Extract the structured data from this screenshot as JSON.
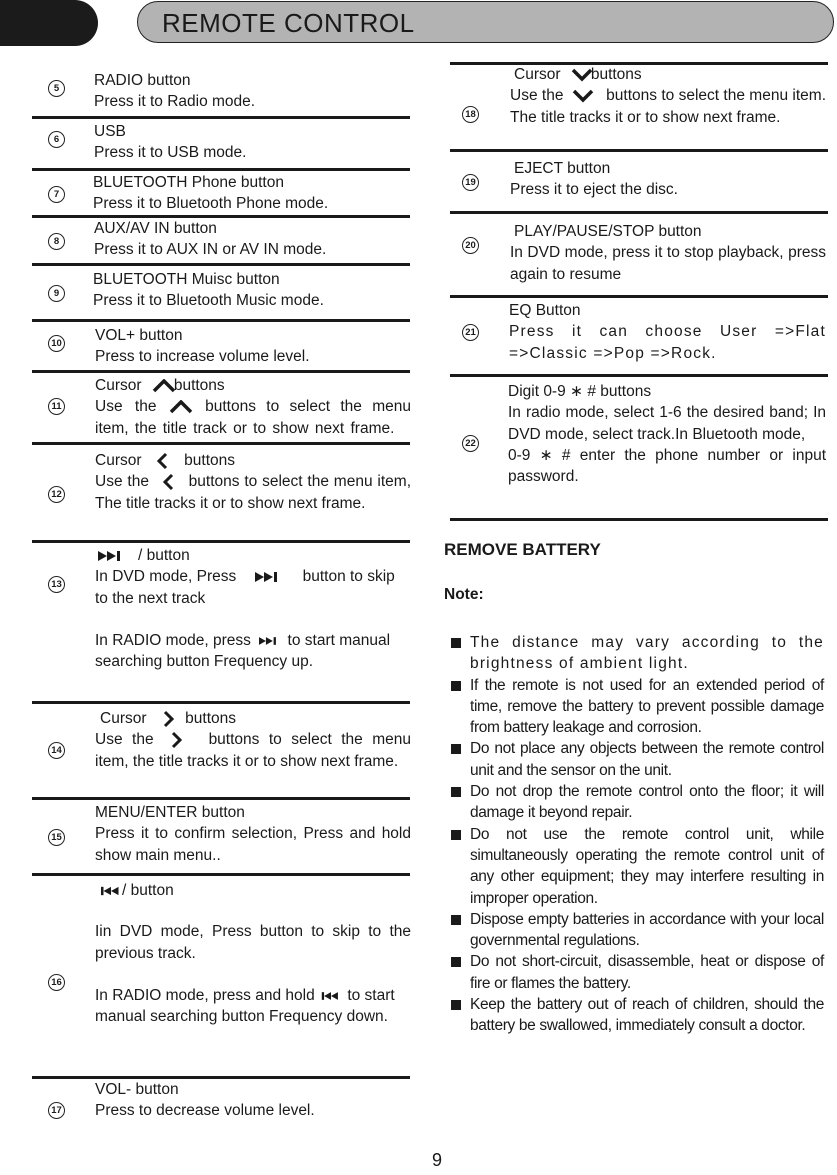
{
  "header": {
    "title": "REMOTE CONTROL"
  },
  "left_items": [
    {
      "num": "5",
      "title": "RADIO button",
      "desc": "Press it to Radio mode."
    },
    {
      "num": "6",
      "title": "USB",
      "desc": "Press it to USB mode."
    },
    {
      "num": "7",
      "title": "BLUETOOTH Phone button",
      "desc": "Press it to Bluetooth Phone mode."
    },
    {
      "num": "8",
      "title": "AUX/AV IN button",
      "desc": "Press it to AUX IN or AV IN mode."
    },
    {
      "num": "9",
      "title": "BLUETOOTH Muisc button",
      "desc": "Press it to Bluetooth Music mode."
    },
    {
      "num": "10",
      "title": "VOL+ button",
      "desc": "Press to increase volume level."
    },
    {
      "num": "11",
      "title_pre": "Cursor",
      "title_post": "buttons",
      "icon": "chevron-up-icon",
      "desc_pre": "Use the",
      "desc_post": "buttons to select the menu item, the title track or to show next frame."
    },
    {
      "num": "12",
      "title_pre": "Cursor",
      "title_post": "buttons",
      "icon": "chevron-left-icon",
      "desc_pre": "Use the",
      "desc_post": "buttons to select the menu item,  The title tracks it or to show next frame."
    },
    {
      "num": "13",
      "title_post": "/ button",
      "icon": "skip-next-icon",
      "line1_pre": "In DVD mode, Press",
      "line1_post": "button to skip to the next track",
      "line2_pre": "In RADIO mode, press",
      "line2_post": "to start manual searching  button Frequency up."
    },
    {
      "num": "14",
      "title_pre": "Cursor",
      "title_post": "buttons",
      "icon": "chevron-right-icon",
      "desc_pre": "Use the",
      "desc_post": "buttons to select the menu item, the title tracks it or to show next frame."
    },
    {
      "num": "15",
      "title": "MENU/ENTER button",
      "desc": "Press it to confirm selection, Press and hold show main menu.."
    },
    {
      "num": "16",
      "title_post": "/ button",
      "icon": "skip-previous-icon",
      "line1": "Iin DVD mode, Press  button to skip to the previous track.",
      "line2_pre": "In RADIO mode, press and hold",
      "line2_post": "to start manual searching   button Frequency down."
    },
    {
      "num": "17",
      "title": "VOL- button",
      "desc": "Press to decrease volume level."
    }
  ],
  "right_items": [
    {
      "num": "18",
      "title_pre": "Cursor",
      "title_post": "buttons",
      "icon": "chevron-down-icon",
      "desc_pre": "Use the",
      "desc_post": "buttons to select the menu item. The title tracks it or to show next frame."
    },
    {
      "num": "19",
      "title": "EJECT button",
      "desc": "Press it to eject the disc."
    },
    {
      "num": "20",
      "title": "PLAY/PAUSE/STOP button",
      "desc": "In DVD mode, press it to stop playback, press again to resume"
    },
    {
      "num": "21",
      "title": "EQ Button",
      "desc": "Press it can choose User =>Flat =>Classic =>Pop =>Rock."
    },
    {
      "num": "22",
      "title": "Digit 0-9  ∗  # buttons",
      "desc": "In radio mode, select 1-6 the desired band; In DVD mode, select track.In Bluetooth mode,",
      "desc2": "0-9 ∗  # enter the phone number or input password."
    }
  ],
  "battery": {
    "heading": "REMOVE BATTERY",
    "note_label": "Note:",
    "notes": [
      "The distance may vary according to the brightness of ambient light.",
      "If the remote is not used for an extended period of time, remove the battery to prevent possible damage from battery leakage and corrosion.",
      " Do not place any objects between the remote control unit and the sensor on the unit.",
      "Do not drop the remote control onto the floor; it will damage it beyond repair.",
      "Do not use the remote control unit, while simultaneously operating the remote control unit of any other equipment; they may interfere resulting in improper operation.",
      "Dispose empty batteries in accordance with your local governmental regulations.",
      "Do not short-circuit, disassemble, heat or dispose of fire or flames the battery.",
      "Keep the battery out of reach of children, should the battery be swallowed, immediately consult a doctor."
    ]
  },
  "footer": {
    "page_number": "9"
  }
}
